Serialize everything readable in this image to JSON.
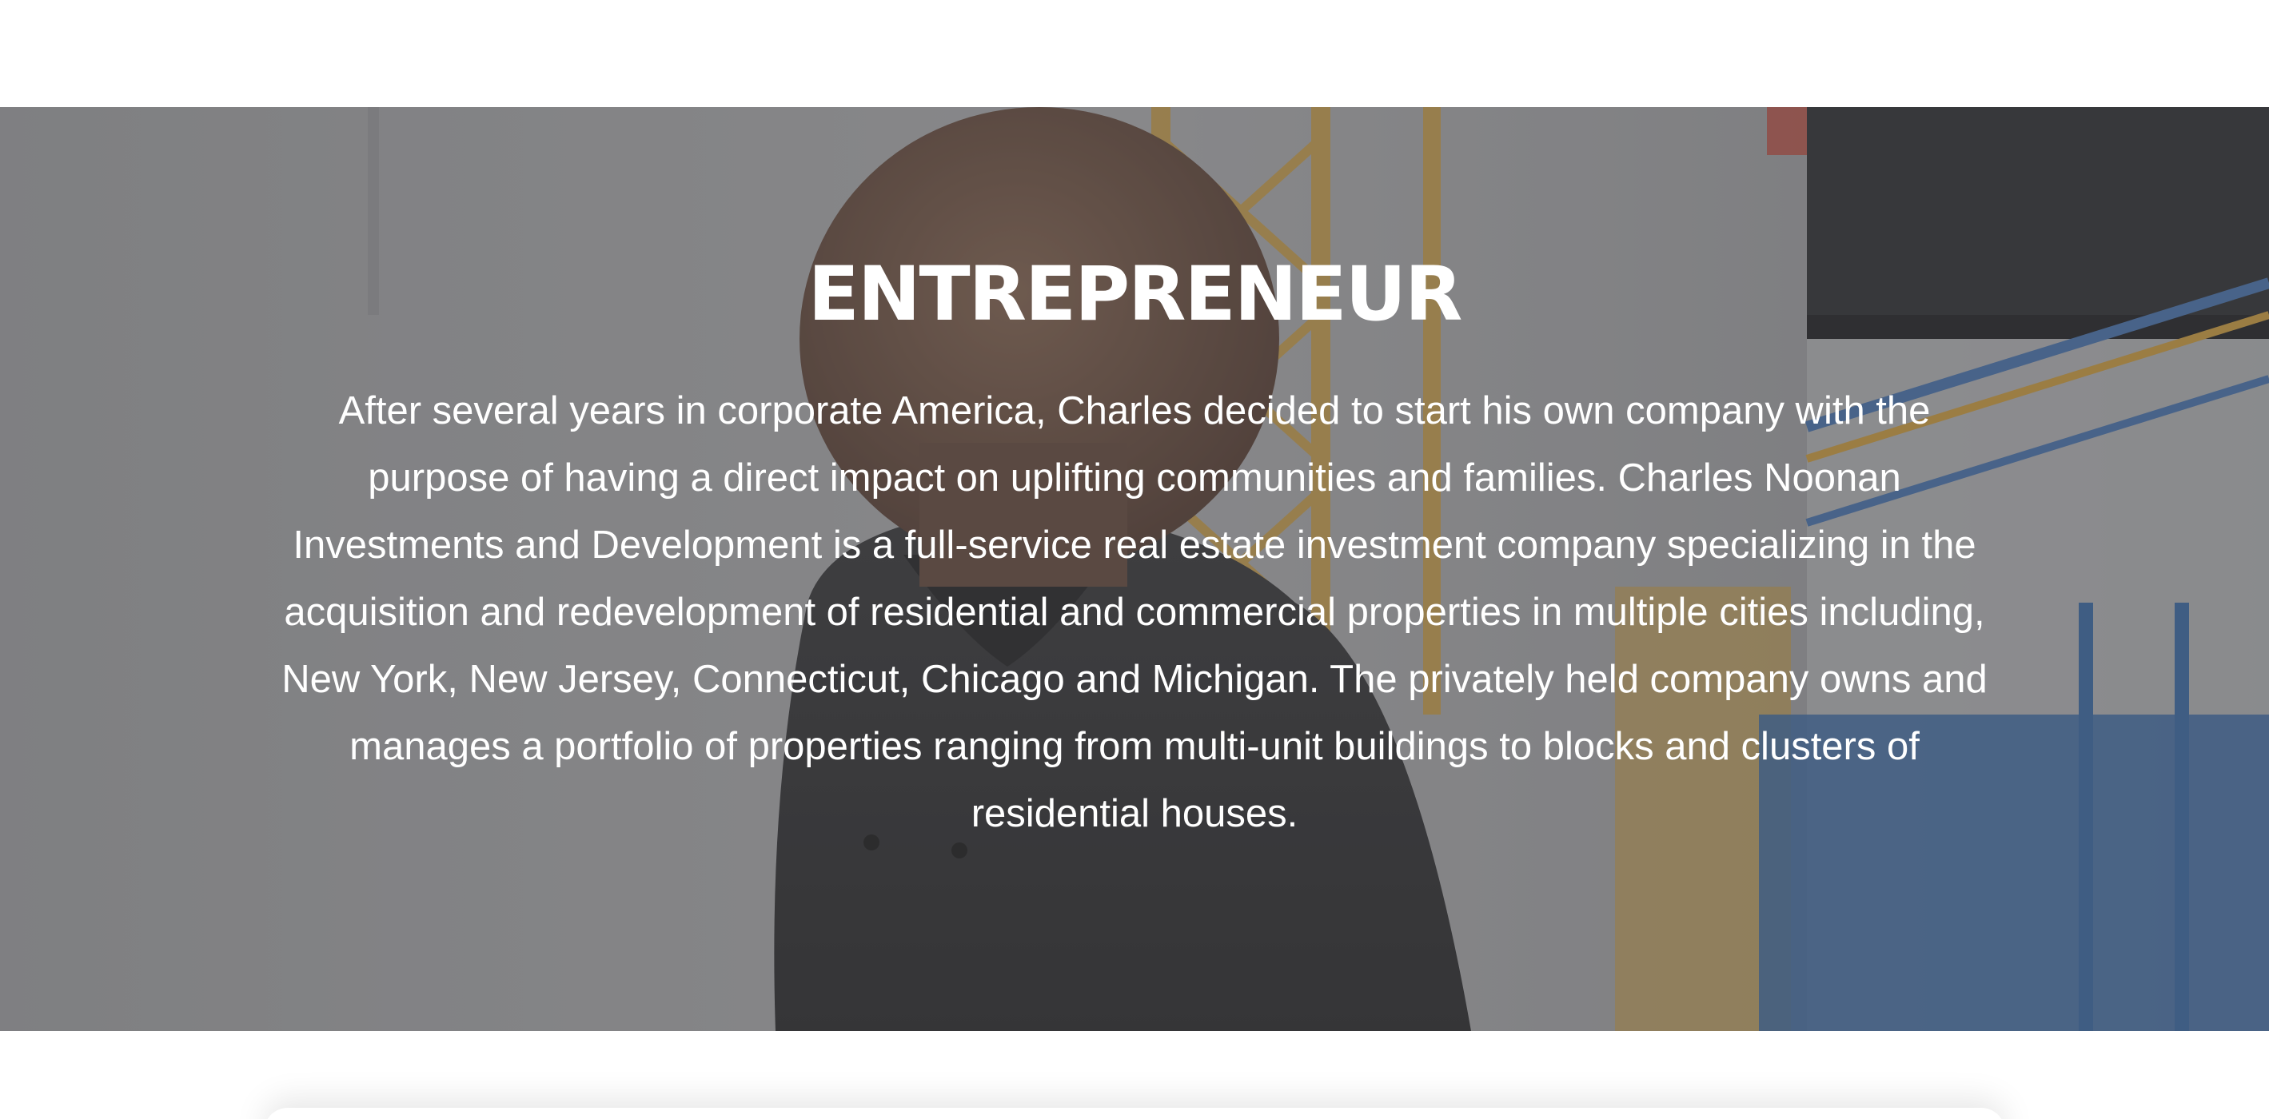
{
  "hero": {
    "title": "ENTREPRENEUR",
    "body": "After several years in corporate America, Charles decided to start his own company with the purpose of having a direct impact on uplifting communities and families. Charles Noonan Investments and Development is a full-service real estate investment company specializing in the acquisition and redevelopment of residential and commercial properties in multiple cities including, New York, New Jersey, Connecticut, Chicago and Michigan. The privately held company owns and manages a portfolio of properties ranging from multi-unit buildings to blocks and clusters of residential houses."
  },
  "colors": {
    "overlay": "#464648",
    "text": "#ffffff",
    "crane": "#d9a640",
    "building_blue": "#3b6fae",
    "shirt": "#2b2b2d",
    "skin": "#7a5a48"
  }
}
